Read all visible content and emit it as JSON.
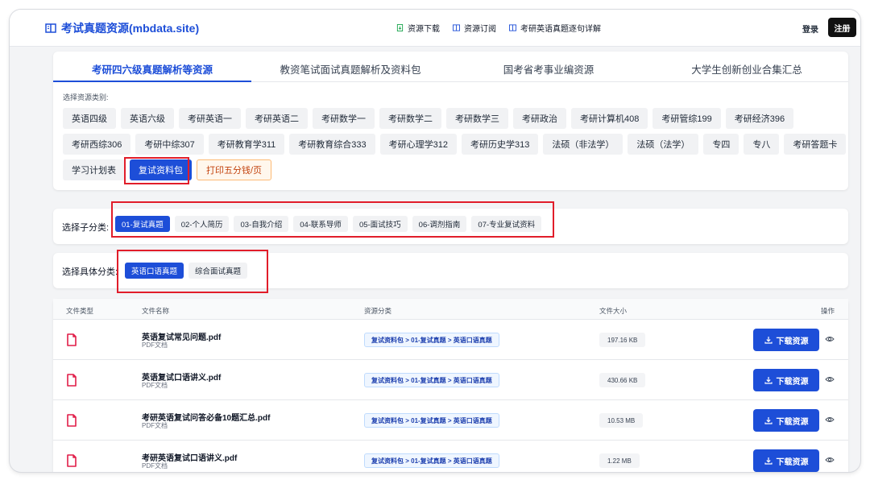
{
  "header": {
    "brand": "考试真题资源(mbdata.site)",
    "nav": [
      {
        "label": "资源下载",
        "icon": "download-doc-icon"
      },
      {
        "label": "资源订阅",
        "icon": "subscribe-icon"
      },
      {
        "label": "考研英语真题逐句详解",
        "icon": "book-icon"
      }
    ],
    "login": "登录",
    "register": "注册"
  },
  "tabs": [
    "考研四六级真题解析等资源",
    "教资笔试面试真题解析及资料包",
    "国考省考事业编资源",
    "大学生创新创业合集汇总"
  ],
  "category_label": "选择资源类别:",
  "categories": [
    [
      "英语四级",
      "英语六级",
      "考研英语一",
      "考研英语二",
      "考研数学一",
      "考研数学二",
      "考研数学三",
      "考研政治",
      "考研计算机408",
      "考研管综199",
      "考研经济396"
    ],
    [
      "考研西综306",
      "考研中综307",
      "考研教育学311",
      "考研教育综合333",
      "考研心理学312",
      "考研历史学313",
      "法硕（非法学）",
      "法硕（法学）",
      "专四",
      "专八",
      "考研答题卡"
    ],
    [
      "学习计划表",
      "复试资料包",
      "打印五分钱/页"
    ]
  ],
  "sub_label": "选择子分类:",
  "subcategories": [
    "01-复试真题",
    "02-个人简历",
    "03-自我介绍",
    "04-联系导师",
    "05-面试技巧",
    "06-调剂指南",
    "07-专业复试资料"
  ],
  "spec_label": "选择具体分类:",
  "specifics": [
    "英语口语真题",
    "综合面试真题"
  ],
  "table": {
    "headers": {
      "type": "文件类型",
      "name": "文件名称",
      "category": "资源分类",
      "size": "文件大小",
      "action": "操作"
    },
    "download_label": "下载资源",
    "rows": [
      {
        "name": "英语复试常见问题.pdf",
        "type": "PDF文档",
        "category": "复试资料包 > 01-复试真题 > 英语口语真题",
        "size": "197.16 KB"
      },
      {
        "name": "英语复试口语讲义.pdf",
        "type": "PDF文档",
        "category": "复试资料包 > 01-复试真题 > 英语口语真题",
        "size": "430.66 KB"
      },
      {
        "name": "考研英语复试问答必备10题汇总.pdf",
        "type": "PDF文档",
        "category": "复试资料包 > 01-复试真题 > 英语口语真题",
        "size": "10.53 MB"
      },
      {
        "name": "考研英语复试口语讲义.pdf",
        "type": "PDF文档",
        "category": "复试资料包 > 01-复试真题 > 英语口语真题",
        "size": "1.22 MB"
      }
    ]
  },
  "colors": {
    "accent": "#1d4ed8",
    "highlight": "#e11d2a",
    "file_icon": "#e11d48"
  }
}
